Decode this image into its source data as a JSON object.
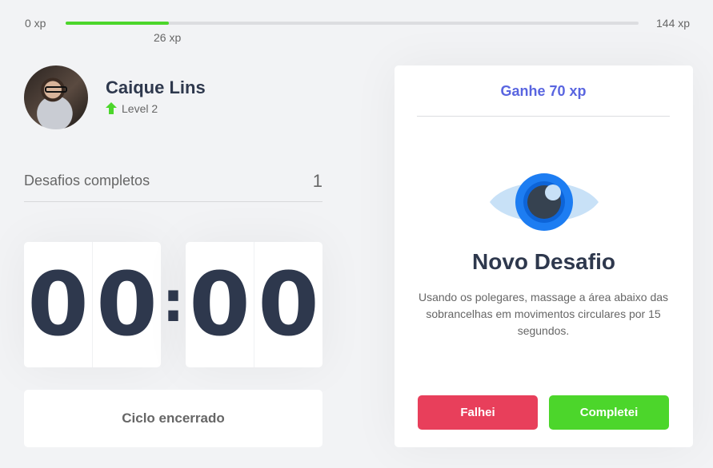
{
  "experience": {
    "min_label": "0 xp",
    "max_label": "144 xp",
    "current_label": "26 xp",
    "current_value": 26,
    "max_value": 144,
    "bar_color": "#4cd62b"
  },
  "profile": {
    "name": "Caique Lins",
    "level_label": "Level 2",
    "level_icon": "level-up-arrow-icon"
  },
  "completed": {
    "label": "Desafios completos",
    "count": "1"
  },
  "countdown": {
    "minute_left": "0",
    "minute_right": "0",
    "separator": ":",
    "second_left": "0",
    "second_right": "0"
  },
  "cycle": {
    "button_label": "Ciclo encerrado"
  },
  "challenge": {
    "header": "Ganhe 70 xp",
    "icon": "eye-icon",
    "title": "Novo Desafio",
    "description": "Usando os polegares, massage a área abaixo das sobrancelhas em movimentos circulares por 15 segundos.",
    "fail_label": "Falhei",
    "succeed_label": "Completei"
  },
  "colors": {
    "accent_blue": "#5965e0",
    "success_green": "#4cd62b",
    "fail_red": "#e83f5b",
    "title_dark": "#2e384d",
    "background": "#f2f3f5"
  }
}
